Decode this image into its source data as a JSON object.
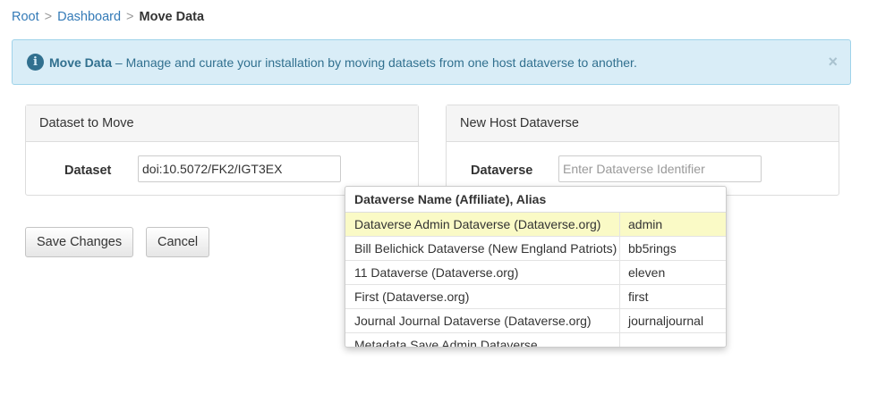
{
  "breadcrumb": {
    "items": [
      "Root",
      "Dashboard"
    ],
    "separator": ">",
    "current": "Move Data"
  },
  "alert": {
    "title": "Move Data",
    "message": " – Manage and curate your installation by moving datasets from one host dataverse to another.",
    "close": "×",
    "info_glyph": "i"
  },
  "left_panel": {
    "heading": "Dataset to Move",
    "label": "Dataset",
    "value": "doi:10.5072/FK2/IGT3EX"
  },
  "right_panel": {
    "heading": "New Host Dataverse",
    "label": "Dataverse",
    "placeholder": "Enter Dataverse Identifier"
  },
  "buttons": {
    "save": "Save Changes",
    "cancel": "Cancel"
  },
  "dropdown": {
    "header": "Dataverse Name (Affiliate), Alias",
    "rows": [
      {
        "name": "Dataverse Admin Dataverse (Dataverse.org)",
        "alias": "admin"
      },
      {
        "name": "Bill Belichick Dataverse (New England Patriots)",
        "alias": "bb5rings"
      },
      {
        "name": "11 Dataverse (Dataverse.org)",
        "alias": "eleven"
      },
      {
        "name": "First (Dataverse.org)",
        "alias": "first"
      },
      {
        "name": "Journal Journal Dataverse (Dataverse.org)",
        "alias": "journaljournal"
      },
      {
        "name": "Metadata Save Admin Dataverse",
        "alias": ""
      }
    ]
  },
  "colors": {
    "link": "#337ab7",
    "alert_bg": "#d9edf7",
    "alert_text": "#31708f",
    "highlight": "#fafac6"
  }
}
